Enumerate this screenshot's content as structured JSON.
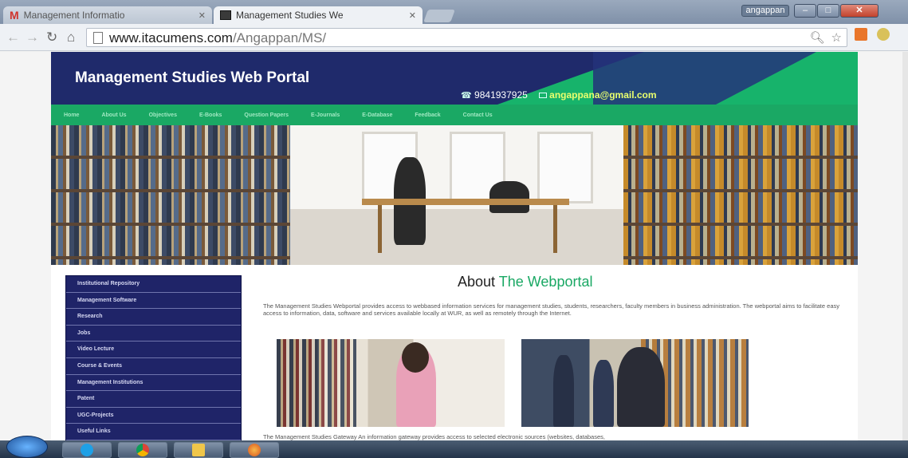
{
  "browser": {
    "tabs": [
      {
        "label": "Management Informatio",
        "active": false,
        "favicon": "gmail-icon"
      },
      {
        "label": "Management Studies We",
        "active": true,
        "favicon": "site-icon"
      }
    ],
    "user_badge": "angappan",
    "url": {
      "host": "www.itacumens.com",
      "path": "/Angappan/MS/"
    }
  },
  "site": {
    "title": "Management Studies Web Portal",
    "phone": "9841937925",
    "email": "angappana@gmail.com",
    "nav": [
      "Home",
      "About Us",
      "Objectives",
      "E-Books",
      "Question Papers",
      "E-Journals",
      "E-Database",
      "Feedback",
      "Contact Us"
    ],
    "sidebar": [
      "Institutional Repository",
      "Management Software",
      "Research",
      "Jobs",
      "Video Lecture",
      "Course & Events",
      "Management Institutions",
      "Patent",
      "UGC-Projects",
      "Useful Links"
    ],
    "about": {
      "title_prefix": "About",
      "title_accent": "The Webportal",
      "text": "The Management Studies Webportal provides access to webbased information services for management studies, students, researchers, faculty members in business administration. The webportal aims to facilitate easy access to information, data, software and services available locally at WUR, as well as remotely through the Internet.",
      "bottom_text": "The Management Studies Gateway An information gateway provides access to selected electronic sources (websites, databases,"
    }
  },
  "colors": {
    "navy": "#1f2a6b",
    "green": "#1aa864",
    "sidebar": "#1f2468"
  }
}
